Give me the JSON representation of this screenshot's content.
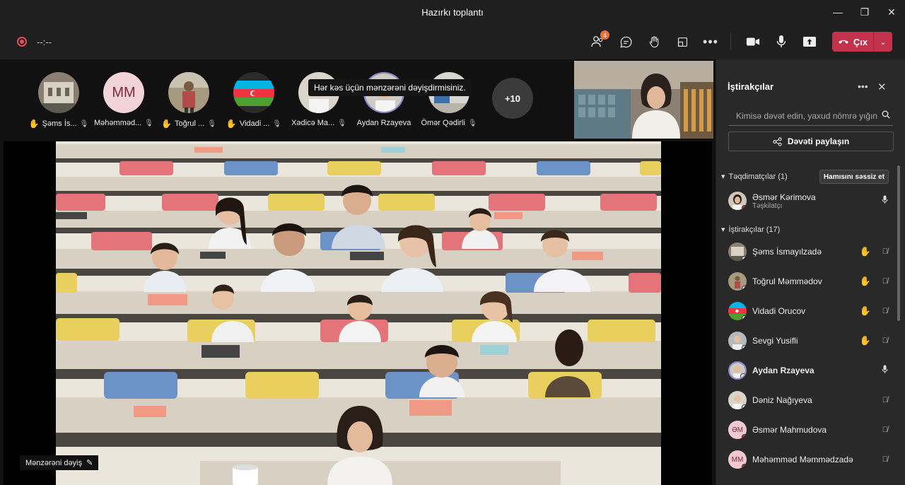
{
  "window": {
    "title": "Hazırkı toplantı",
    "controls": [
      "—",
      "❐",
      "✕"
    ]
  },
  "toolbar": {
    "timer": "--:--",
    "participants_badge": "4",
    "leave_label": "Çıx",
    "accent": "#c4314b"
  },
  "stage": {
    "tooltip": "Hər kəs üçün mənzərəni dəyişdirmisiniz.",
    "change_bg_label": "Mənzərəni dəyiş",
    "more_label": "+10",
    "avatars": [
      {
        "name": "Şəms İs...",
        "hand": true
      },
      {
        "initials": "MM",
        "name": "Məhəmməd...",
        "hand": false
      },
      {
        "name": "Toğrul ...",
        "hand": true
      },
      {
        "name": "Vidadi ...",
        "hand": true
      },
      {
        "name": "Xədicə Ma...",
        "hand": false
      },
      {
        "name": "Aydan Rzayeva",
        "hand": false
      },
      {
        "name": "Ömər Qədirli",
        "hand": false
      }
    ]
  },
  "panel": {
    "title": "İştirakçılar",
    "invite_placeholder": "Kimisə dəvət edin, yaxud nömrə yığın",
    "share_label": "Dəvəti paylaşın",
    "presenters_header": "Təqdimatçılar (1)",
    "mute_all_label": "Hamısını səssiz et",
    "attendees_header": "İştirakçılar (17)",
    "presenter": {
      "name": "Əsmər Kərimova",
      "role": "Təşkilatçı"
    },
    "attendees": [
      {
        "name": "Şəms İsmayılzadə",
        "hand": true
      },
      {
        "name": "Toğrul Məmmədov",
        "hand": true
      },
      {
        "name": "Vidadi Orucov",
        "hand": true
      },
      {
        "name": "Sevgi Yusifli",
        "hand": true
      },
      {
        "name": "Aydan Rzayeva",
        "hand": false
      },
      {
        "name": "Dəniz Nağıyeva",
        "hand": false
      },
      {
        "initials": "ƏM",
        "name": "Əsmər Mahmudova",
        "hand": false
      },
      {
        "initials": "MM",
        "name": "Məhəmməd Məmmədzadə",
        "hand": false
      }
    ]
  }
}
